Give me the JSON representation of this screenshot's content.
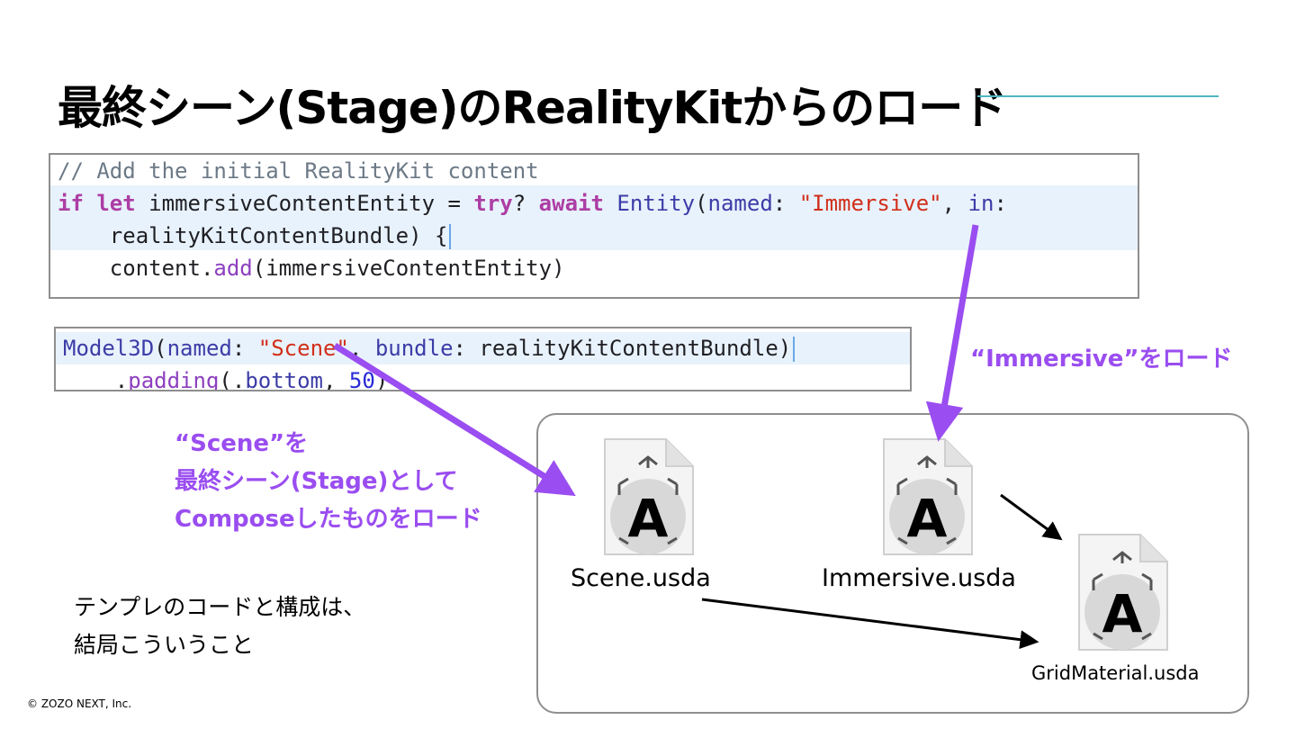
{
  "slide": {
    "title": "最終シーン(Stage)のRealityKitからのロード",
    "code_block_1": {
      "lines": [
        [
          {
            "t": "// Add the initial RealityKit content",
            "c": "c-comment"
          }
        ],
        [
          {
            "t": "if",
            "c": "c-kw"
          },
          {
            "t": " ",
            "c": "c-plain"
          },
          {
            "t": "let",
            "c": "c-kw"
          },
          {
            "t": " immersiveContentEntity = ",
            "c": "c-plain"
          },
          {
            "t": "try",
            "c": "c-kw"
          },
          {
            "t": "? ",
            "c": "c-plain"
          },
          {
            "t": "await",
            "c": "c-kw"
          },
          {
            "t": " ",
            "c": "c-plain"
          },
          {
            "t": "Entity",
            "c": "c-type"
          },
          {
            "t": "(",
            "c": "c-plain"
          },
          {
            "t": "named",
            "c": "c-type"
          },
          {
            "t": ": ",
            "c": "c-plain"
          },
          {
            "t": "\"Immersive\"",
            "c": "c-str"
          },
          {
            "t": ", ",
            "c": "c-plain"
          },
          {
            "t": "in",
            "c": "c-type"
          },
          {
            "t": ":",
            "c": "c-plain"
          }
        ],
        [
          {
            "t": "    realityKitContentBundle) {",
            "c": "c-plain"
          }
        ],
        [
          {
            "t": "    content.",
            "c": "c-plain"
          },
          {
            "t": "add",
            "c": "c-fn"
          },
          {
            "t": "(immersiveContentEntity)",
            "c": "c-plain"
          }
        ]
      ]
    },
    "code_block_2": {
      "lines": [
        [
          {
            "t": "Model3D",
            "c": "c-type"
          },
          {
            "t": "(",
            "c": "c-plain"
          },
          {
            "t": "named",
            "c": "c-type"
          },
          {
            "t": ": ",
            "c": "c-plain"
          },
          {
            "t": "\"Scene\"",
            "c": "c-str"
          },
          {
            "t": ", ",
            "c": "c-plain"
          },
          {
            "t": "bundle",
            "c": "c-type"
          },
          {
            "t": ": realityKitContentBundle)",
            "c": "c-plain"
          }
        ],
        [
          {
            "t": "    .",
            "c": "c-plain"
          },
          {
            "t": "padding",
            "c": "c-fn"
          },
          {
            "t": "(.",
            "c": "c-plain"
          },
          {
            "t": "bottom",
            "c": "c-type"
          },
          {
            "t": ", ",
            "c": "c-plain"
          },
          {
            "t": "50",
            "c": "c-num"
          },
          {
            "t": ")",
            "c": "c-plain"
          }
        ]
      ]
    },
    "label_immersive": "“Immersive”をロード",
    "label_scene": {
      "line1": "“Scene”を",
      "line2": "最終シーン(Stage)として",
      "line3": "Composeしたものをロード"
    },
    "files": {
      "scene": "Scene.usda",
      "immersive": "Immersive.usda",
      "grid": "GridMaterial.usda",
      "icon_letter": "A"
    },
    "note": {
      "line1": "テンプレのコードと構成は、",
      "line2": "結局こういうこと"
    },
    "copyright": "© ZOZO NEXT, Inc."
  },
  "colors": {
    "accent_purple": "#9a4df0",
    "title_rule": "#4fb7c3",
    "code_highlight": "#e8f2fc"
  }
}
